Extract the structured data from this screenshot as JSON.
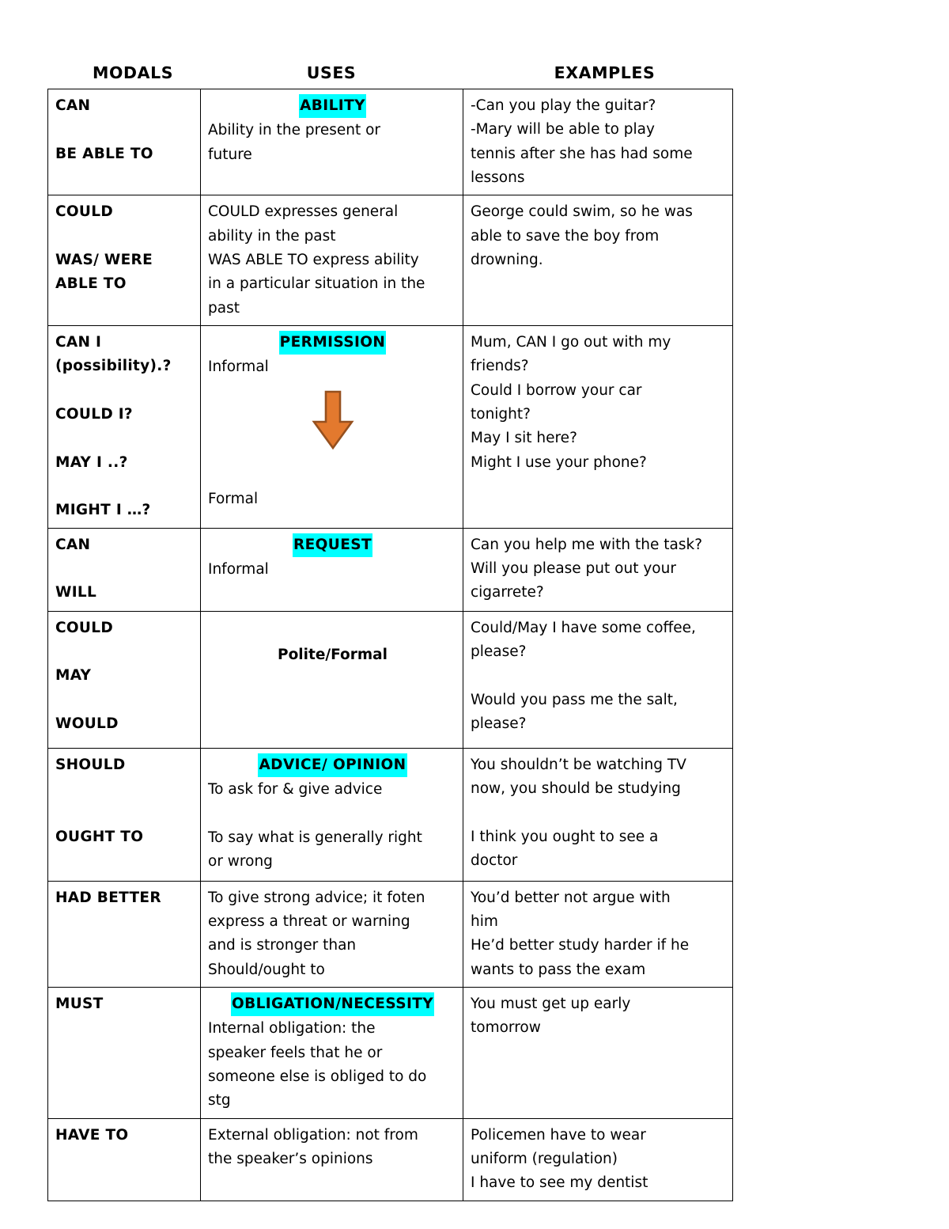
{
  "document": {
    "title": "MODALS / USES / EXAMPLES reference table"
  },
  "headers": {
    "modals": "MODALS",
    "uses": "USES",
    "examples": "EXAMPLES"
  },
  "colors": {
    "highlight": "#00FFFF",
    "arrow_fill": "#E3792E",
    "arrow_stroke": "#96501E",
    "text": "#000000",
    "border": "#000000"
  },
  "icons": {
    "down_arrow": "down-arrow-icon"
  },
  "rows": [
    {
      "id": "ability",
      "modals": [
        "CAN",
        "",
        "BE ABLE TO"
      ],
      "use_heading": "ABILITY",
      "use_heading_highlighted": true,
      "uses": [
        "Ability in the present or",
        "future"
      ],
      "examples": [
        "-Can you play the guitar?",
        "-Mary will be able to play",
        "tennis after she has had some",
        "lessons"
      ]
    },
    {
      "id": "could-ability-past",
      "modals": [
        "COULD",
        "",
        "WAS/ WERE",
        "ABLE TO"
      ],
      "use_heading": "",
      "use_heading_highlighted": false,
      "uses": [
        "COULD expresses general",
        "ability in the past",
        "WAS ABLE TO express ability",
        "in a particular situation in the",
        "past"
      ],
      "examples": [
        "George could swim, so he was",
        "able to save the boy from",
        "drowning."
      ]
    },
    {
      "id": "permission",
      "modals": [
        "CAN I",
        "(possibility).?",
        "",
        "COULD I?",
        "",
        "MAY I ..?",
        "",
        "MIGHT I …?"
      ],
      "use_heading": "PERMISSION",
      "use_heading_highlighted": true,
      "uses": [
        "Informal"
      ],
      "uses_after_arrow": [
        "Formal"
      ],
      "has_arrow": true,
      "examples": [
        "Mum, CAN I go out with my",
        "friends?",
        "Could I borrow your car",
        "tonight?",
        "May I sit here?",
        "Might I use your phone?"
      ]
    },
    {
      "id": "request",
      "modals": [
        "CAN",
        "",
        "WILL"
      ],
      "use_heading": "REQUEST",
      "use_heading_highlighted": true,
      "uses": [
        "Informal"
      ],
      "examples": [
        "Can you help me with the task?",
        "Will you please put out your",
        "cigarrete?"
      ]
    },
    {
      "id": "polite-request",
      "modals": [
        "COULD",
        "",
        "MAY",
        "",
        "WOULD"
      ],
      "use_heading": "",
      "use_heading_highlighted": false,
      "use_centered_bold": "Polite/Formal",
      "uses": [],
      "examples": [
        "Could/May I have some coffee,",
        "please?",
        "",
        "Would you pass me the salt,",
        "please?"
      ]
    },
    {
      "id": "advice",
      "modals": [
        "SHOULD",
        "",
        "",
        "OUGHT TO"
      ],
      "use_heading": "ADVICE/ OPINION",
      "use_heading_highlighted": true,
      "uses": [
        "To ask for & give advice",
        "",
        "To say what is generally right",
        "or wrong"
      ],
      "examples": [
        "You shouldn’t be watching TV",
        "now, you should be studying",
        "",
        "I think you ought to see a",
        "doctor"
      ]
    },
    {
      "id": "had-better",
      "modals": [
        "HAD BETTER"
      ],
      "use_heading": "",
      "use_heading_highlighted": false,
      "uses": [
        "To give strong advice; it foten",
        "express a threat or warning",
        "and is stronger than",
        "Should/ought to"
      ],
      "examples": [
        "You’d  better not argue with",
        "him",
        "He’d better study harder if he",
        "wants to pass the exam"
      ]
    },
    {
      "id": "must",
      "modals": [
        "MUST"
      ],
      "use_heading": "OBLIGATION/NECESSITY",
      "use_heading_highlighted": true,
      "uses": [
        "Internal obligation: the",
        "speaker feels that he or",
        "someone else is obliged to do",
        "stg"
      ],
      "examples": [
        "You must get up early",
        "tomorrow"
      ]
    },
    {
      "id": "have-to",
      "modals": [
        "HAVE TO"
      ],
      "use_heading": "",
      "use_heading_highlighted": false,
      "uses": [
        "External obligation: not from",
        "the speaker’s opinions"
      ],
      "examples": [
        "Policemen have to wear",
        "uniform (regulation)",
        "I have to see my dentist"
      ]
    }
  ]
}
